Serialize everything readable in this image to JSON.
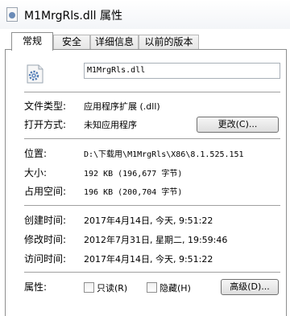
{
  "window": {
    "title": "M1MrgRls.dll 属性"
  },
  "tabs": [
    {
      "label": "常规",
      "active": true
    },
    {
      "label": "安全",
      "active": false
    },
    {
      "label": "详细信息",
      "active": false
    },
    {
      "label": "以前的版本",
      "active": false
    }
  ],
  "general": {
    "filename": "M1MrgRls.dll",
    "file_type_label": "文件类型:",
    "file_type_value": "应用程序扩展 (.dll)",
    "open_with_label": "打开方式:",
    "open_with_value": "未知应用程序",
    "change_button": "更改(C)...",
    "location_label": "位置:",
    "location_value": "D:\\下载用\\M1MrgRls\\X86\\8.1.525.151",
    "size_label": "大小:",
    "size_value": "192 KB (196,677 字节)",
    "size_on_disk_label": "占用空间:",
    "size_on_disk_value": "196 KB (200,704 字节)",
    "created_label": "创建时间:",
    "created_value": "2017年4月14日, 今天, 9:51:22",
    "modified_label": "修改时间:",
    "modified_value": "2012年7月31日, 星期二, 19:59:46",
    "accessed_label": "访问时间:",
    "accessed_value": "2017年4月14日, 今天, 9:51:22",
    "attributes_label": "属性:",
    "readonly_label": "只读(R)",
    "readonly_checked": false,
    "hidden_label": "隐藏(H)",
    "hidden_checked": false,
    "advanced_button": "高级(D)..."
  },
  "icons": {
    "title": "dll-file-icon",
    "file": "gear-file-icon"
  },
  "colors": {
    "window_bg": "#ffffff",
    "border": "#8e8f8f",
    "icon_gear": "#4f7ab3"
  }
}
